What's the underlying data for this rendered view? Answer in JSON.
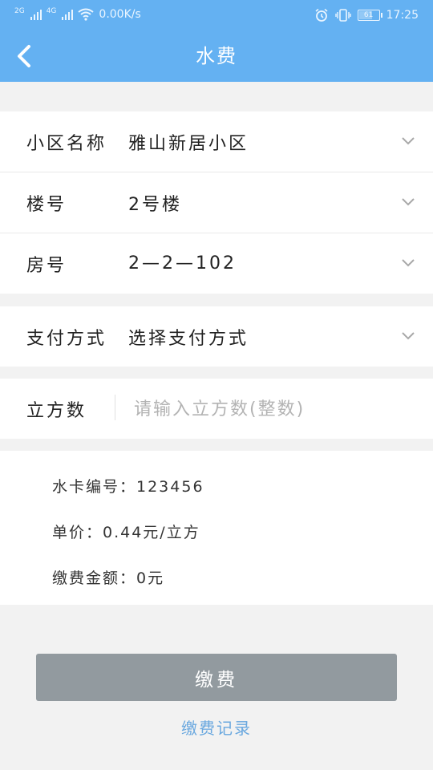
{
  "status_bar": {
    "net_tag_1": "2G",
    "net_tag_2": "4G",
    "speed": "0.00K/s",
    "battery": "61",
    "time": "17:25",
    "icons": [
      "signal-icon",
      "wifi-icon",
      "alarm-icon",
      "vibrate-icon",
      "battery-icon"
    ]
  },
  "header": {
    "title": "水费"
  },
  "form": {
    "community": {
      "label": "小区名称",
      "value": "雅山新居小区"
    },
    "building": {
      "label": "楼号",
      "value": "2号楼"
    },
    "room": {
      "label": "房号",
      "value": "2—2—102"
    },
    "payment_method": {
      "label": "支付方式",
      "value": "选择支付方式"
    },
    "cubic": {
      "label": "立方数",
      "placeholder": "请输入立方数(整数)",
      "value": ""
    }
  },
  "info": {
    "card_no": "水卡编号：123456",
    "unit_price": "单价：0.44元/立方",
    "amount": "缴费金额：0元"
  },
  "actions": {
    "pay_label": "缴费",
    "records_label": "缴费记录"
  },
  "colors": {
    "header": "#64b1f2",
    "button": "#929a9f",
    "link": "#6aa8df"
  }
}
